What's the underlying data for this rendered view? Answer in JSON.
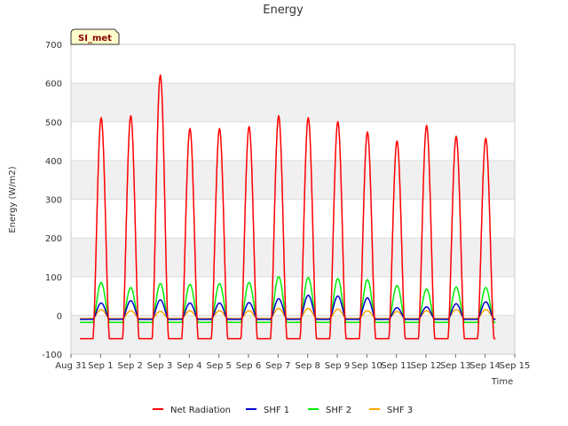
{
  "chart_data": {
    "type": "line",
    "title": "Energy",
    "xlabel": "Time",
    "ylabel": "Energy (W/m2)",
    "ylim": [
      -100,
      700
    ],
    "xlim": [
      0,
      15
    ],
    "yticks": [
      -100,
      0,
      100,
      200,
      300,
      400,
      500,
      600,
      700
    ],
    "xtick_labels": [
      "Aug 31",
      "Sep 1",
      "Sep 2",
      "Sep 3",
      "Sep 4",
      "Sep 5",
      "Sep 6",
      "Sep 7",
      "Sep 8",
      "Sep 9",
      "Sep 10",
      "Sep 11",
      "Sep 12",
      "Sep 13",
      "Sep 14",
      "Sep 15"
    ],
    "badge": "SI_met",
    "grid": true,
    "legend_position": "bottom",
    "daily_peaks_day_index": [
      1,
      2,
      3,
      4,
      5,
      6,
      7,
      8,
      9,
      10,
      11,
      12,
      13,
      14
    ],
    "series": [
      {
        "name": "Net Radiation",
        "color": "#ff0000",
        "daily_peak": [
          510,
          515,
          620,
          482,
          482,
          487,
          515,
          510,
          500,
          473,
          450,
          490,
          462,
          457
        ],
        "night_value": -60
      },
      {
        "name": "SHF 1",
        "color": "#0000cc",
        "daily_peak": [
          32,
          38,
          40,
          32,
          32,
          33,
          43,
          52,
          50,
          45,
          20,
          22,
          30,
          35
        ],
        "night_value": -10
      },
      {
        "name": "SHF 2",
        "color": "#00ee00",
        "daily_peak": [
          85,
          72,
          82,
          80,
          82,
          85,
          100,
          98,
          95,
          92,
          77,
          68,
          73,
          72
        ],
        "night_value": -18
      },
      {
        "name": "SHF 3",
        "color": "#ffa500",
        "daily_peak": [
          15,
          12,
          10,
          12,
          12,
          12,
          18,
          18,
          16,
          12,
          10,
          12,
          15,
          15
        ],
        "night_value": -8
      }
    ]
  }
}
